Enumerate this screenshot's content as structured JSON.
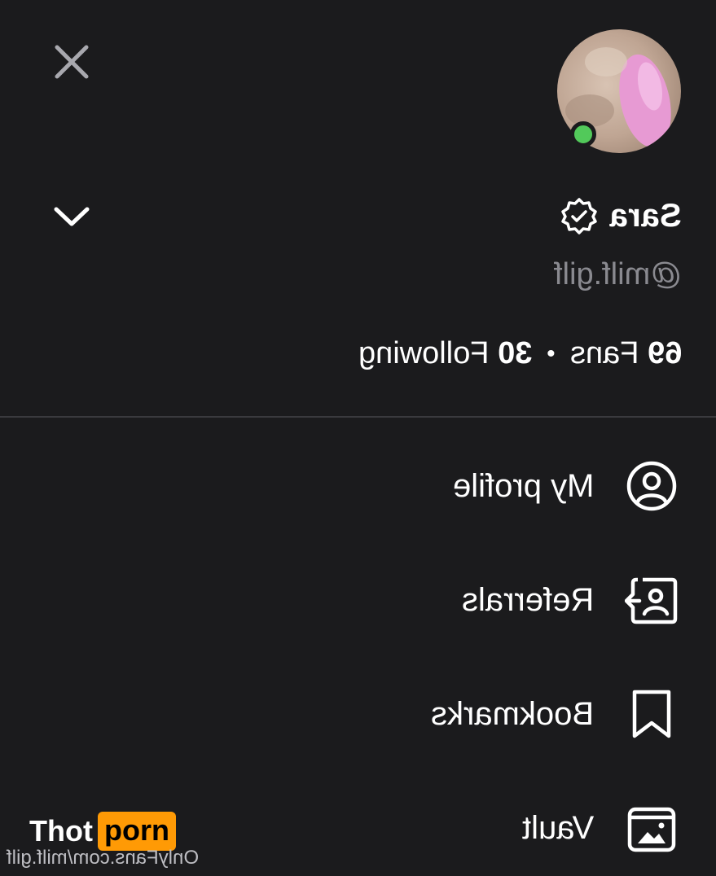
{
  "header": {
    "close_icon": "close-icon",
    "chevron_icon": "chevron-down-icon"
  },
  "profile": {
    "name": "Sara",
    "verified_icon": "verified-badge-icon",
    "username": "@milf.gilf",
    "fans_count": "69",
    "fans_label": "Fans",
    "separator": "•",
    "following_count": "30",
    "following_label": "Following",
    "online_status_color": "#52c95a"
  },
  "menu": {
    "items": [
      {
        "label": "My profile",
        "icon": "user-circle-icon"
      },
      {
        "label": "Referrals",
        "icon": "referral-icon"
      },
      {
        "label": "Bookmarks",
        "icon": "bookmark-icon"
      },
      {
        "label": "Vault",
        "icon": "vault-image-icon"
      }
    ]
  },
  "watermark": {
    "brand_part1": "Thot",
    "brand_part2": "porn",
    "brand_accent": "#ff9a05",
    "url": "OnlyFans.com/milf.gilf"
  },
  "colors": {
    "background": "#1b1b1d",
    "muted_text": "#8a8a90",
    "divider": "#3a3a3e"
  }
}
